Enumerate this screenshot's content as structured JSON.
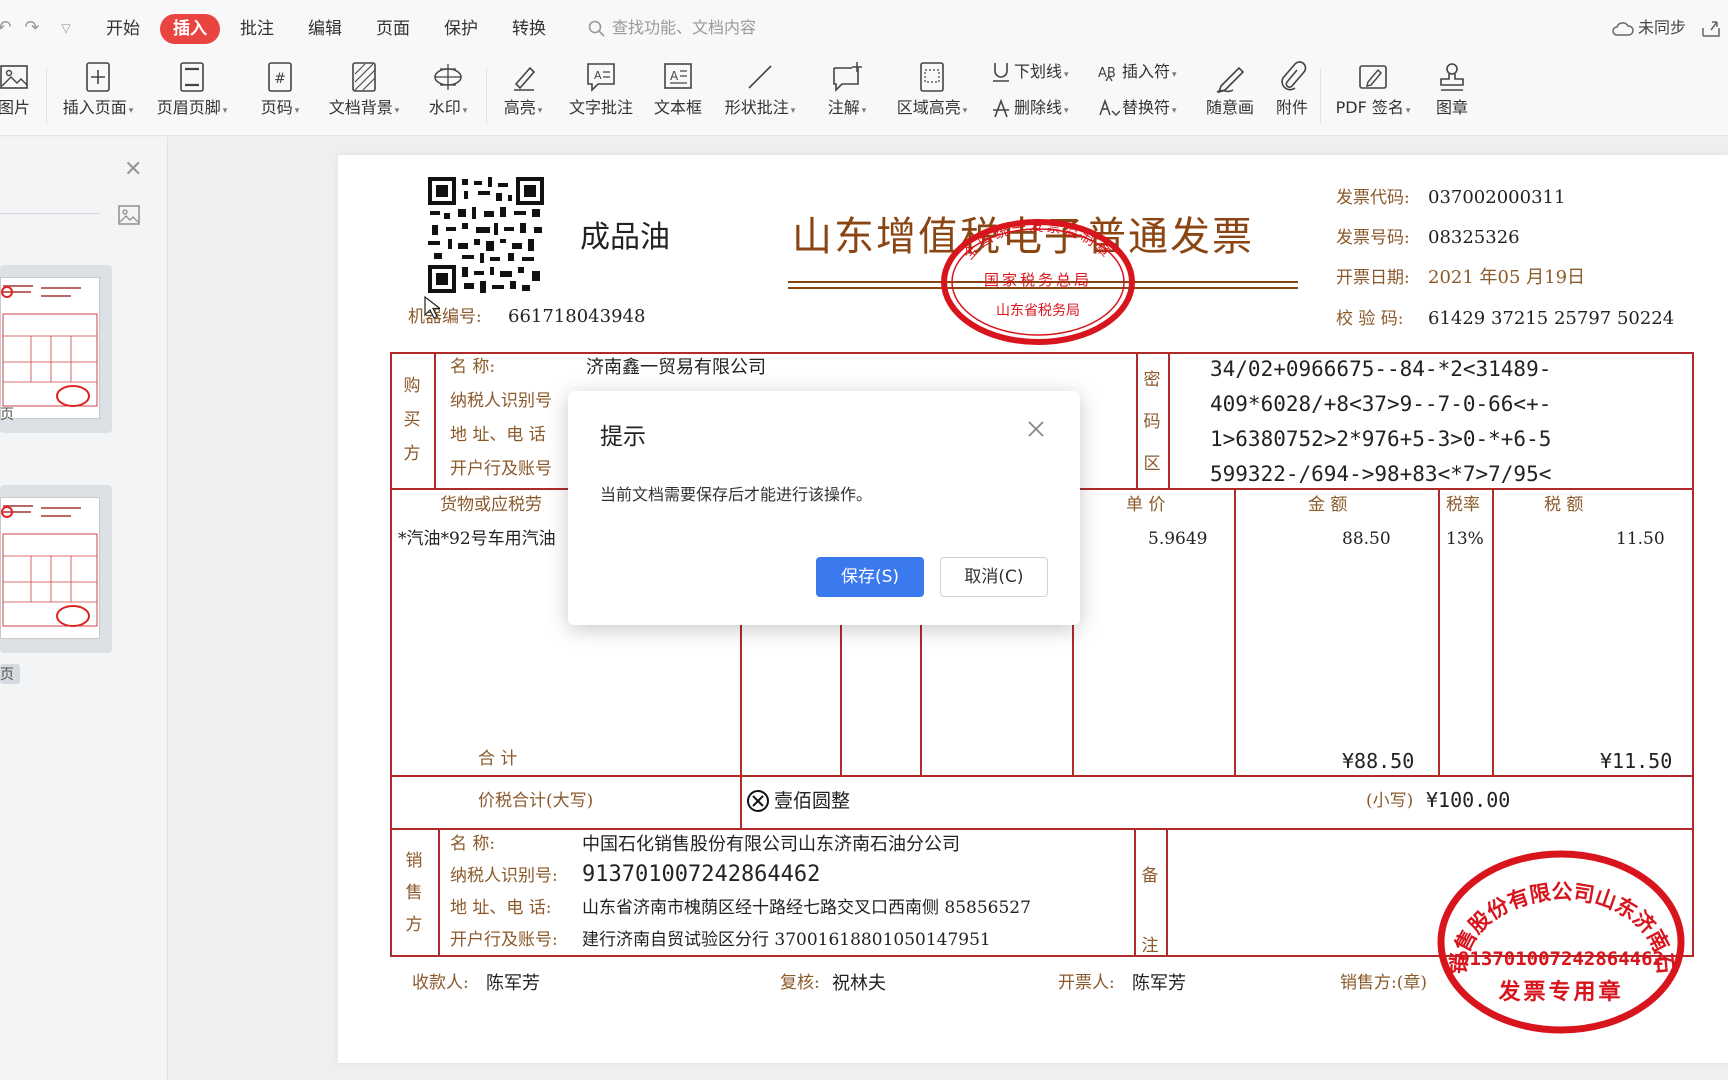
{
  "menubar": {
    "tabs": [
      "开始",
      "插入",
      "批注",
      "编辑",
      "页面",
      "保护",
      "转换"
    ],
    "active_tab": "插入",
    "search_placeholder": "查找功能、文档内容",
    "sync_status": "未同步"
  },
  "ribbon": {
    "picture": "图片",
    "insert_page": "插入页面",
    "header_footer": "页眉页脚",
    "page_number": "页码",
    "doc_background": "文档背景",
    "watermark": "水印",
    "highlight": "高亮",
    "text_comment": "文字批注",
    "textbox": "文本框",
    "shape_comment": "形状批注",
    "annotation": "注解",
    "area_highlight": "区域高亮",
    "underline": "下划线",
    "strikethrough": "删除线",
    "insert_symbol": "插入符",
    "replace_symbol": "替换符",
    "freehand": "随意画",
    "attachment": "附件",
    "pdf_sign": "PDF 签名",
    "stamp": "图章"
  },
  "sidebar": {
    "page_label_1": "页",
    "page_label_2": "页"
  },
  "invoice": {
    "product_type": "成品油",
    "title": "山东增值税电子普通发票",
    "machine_no_label": "机器编号:",
    "machine_no": "661718043948",
    "code_label": "发票代码:",
    "code": "037002000311",
    "number_label": "发票号码:",
    "number": "08325326",
    "date_label": "开票日期:",
    "date": "2021 年05 月19日",
    "check_label": "校 验 码:",
    "check_code": "61429 37215 25797 50224",
    "buyer_side": "购买方",
    "buyer_name_label": "名        称:",
    "buyer_name": "济南鑫一贸易有限公司",
    "buyer_tax_label": "纳税人识别号",
    "buyer_addr_label": "地 址、电 话",
    "buyer_bank_label": "开户行及账号",
    "cipher_side": "密码区",
    "cipher_lines": [
      "34/02+0966675--84-*2<31489-",
      "409*6028/+8<37>9--7-0-66<+-",
      "1>6380752>2*976+5-3>0-*+6-5",
      "599322-/694->98+83<*7>7/95<"
    ],
    "col_goods": "货物或应税劳",
    "col_unit_price": "单 价",
    "col_amount": "金   额",
    "col_tax_rate": "税率",
    "col_tax": "税   额",
    "item_name": "*汽油*92号车用汽油",
    "item_unit_price": "5.9649",
    "item_amount": "88.50",
    "item_tax_rate": "13%",
    "item_tax": "11.50",
    "total_label": "合      计",
    "total_amount": "¥88.50",
    "total_tax": "¥11.50",
    "grand_label": "价税合计(大写)",
    "grand_upper": "壹佰圆整",
    "grand_lower_label": "(小写)",
    "grand_lower": "¥100.00",
    "seller_side": "销售方",
    "seller_name_label": "名        称:",
    "seller_name": "中国石化销售股份有限公司山东济南石油分公司",
    "seller_tax_label": "纳税人识别号:",
    "seller_tax": "913701007242864462",
    "seller_addr_label": "地 址、电 话:",
    "seller_addr": "山东省济南市槐荫区经十路经七路交叉口西南侧 85856527",
    "seller_bank_label": "开户行及账号:",
    "seller_bank": "建行济南自贸试验区分行 37001618801050147951",
    "remark_side": "备注",
    "payee_label": "收款人:",
    "payee": "陈军芳",
    "reviewer_label": "复核:",
    "reviewer": "祝林夫",
    "issuer_label": "开票人:",
    "issuer": "陈军芳",
    "seller_seal_label": "销售方:(章)",
    "tax_seal_top": "全国统一发票监制章",
    "tax_seal_mid": "国家税务总局",
    "tax_seal_bottom": "山东省税务局",
    "company_seal_ring": "中国石化销售股份有限公司山东济南石油分公司",
    "company_seal_no": "913701007242864462",
    "company_seal_bottom": "发票专用章"
  },
  "dialog": {
    "title": "提示",
    "message": "当前文档需要保存后才能进行该操作。",
    "save_button": "保存(S)",
    "cancel_button": "取消(C)"
  }
}
